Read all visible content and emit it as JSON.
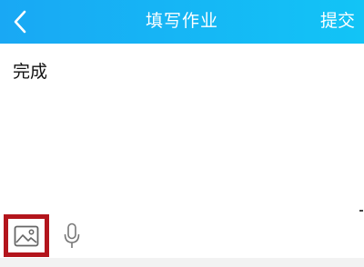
{
  "header": {
    "back_icon": "chevron-left-icon",
    "title": "填写作业",
    "submit_label": "提交",
    "gradient_start": "#19a8f4",
    "gradient_end": "#12c4f6"
  },
  "editor": {
    "text": "完成"
  },
  "toolbar": {
    "image_icon": "image-icon",
    "mic_icon": "microphone-icon",
    "highlight_color": "#b3151c"
  }
}
